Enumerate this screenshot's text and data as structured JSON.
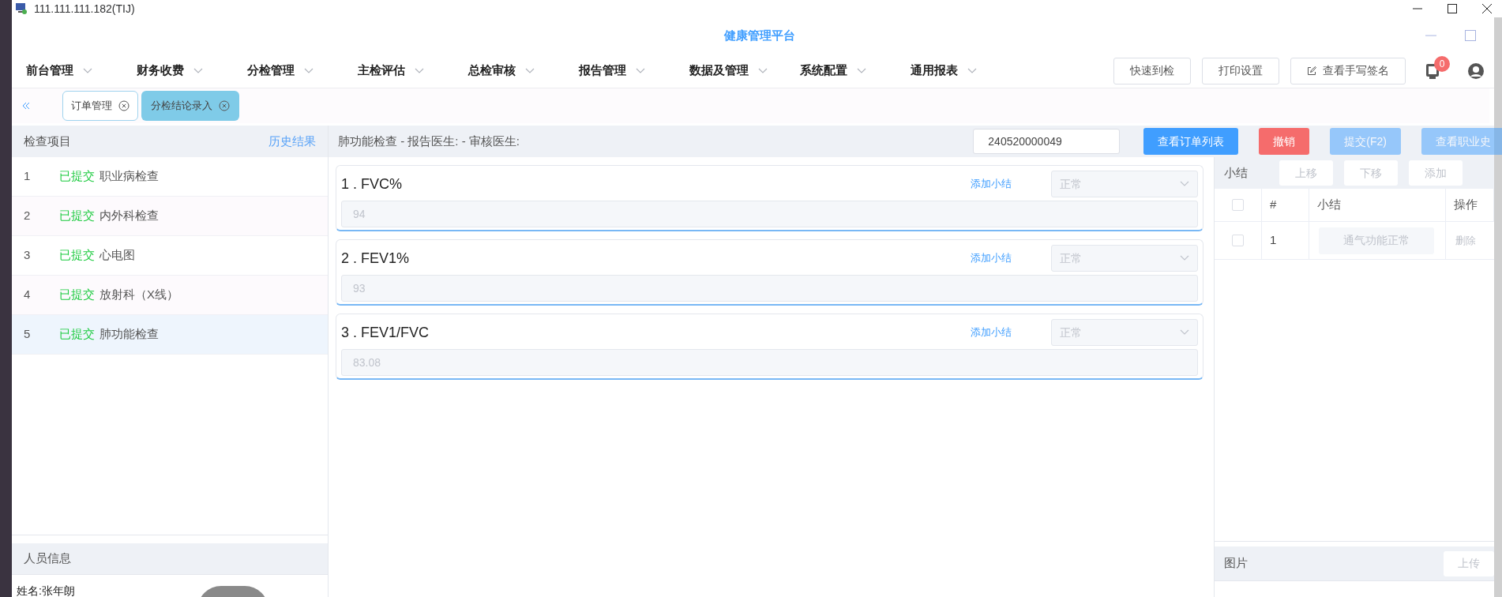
{
  "titlebar": {
    "title": "111.111.111.182(TIJ)"
  },
  "app_title": "健康管理平台",
  "menu": [
    {
      "label": "前台管理"
    },
    {
      "label": "财务收费"
    },
    {
      "label": "分检管理"
    },
    {
      "label": "主检评估"
    },
    {
      "label": "总检审核"
    },
    {
      "label": "报告管理"
    },
    {
      "label": "数据及管理"
    },
    {
      "label": "系统配置"
    },
    {
      "label": "通用报表"
    }
  ],
  "toolbar_buttons": [
    {
      "label": "快速到检",
      "kind": "plain"
    },
    {
      "label": "打印设置",
      "kind": "plain"
    },
    {
      "label": "查看手写签名",
      "kind": "edit"
    }
  ],
  "notifications": {
    "count": "0"
  },
  "tabs": [
    {
      "label": "订单管理",
      "selected": false
    },
    {
      "label": "分检结论录入",
      "selected": true
    }
  ],
  "exam_list": {
    "title": "检查项目",
    "history_link": "历史结果",
    "items": [
      {
        "index": "1",
        "status": "已提交",
        "name": "职业病检查",
        "selected": false
      },
      {
        "index": "2",
        "status": "已提交",
        "name": "内外科检查",
        "selected": false
      },
      {
        "index": "3",
        "status": "已提交",
        "name": "心电图",
        "selected": false
      },
      {
        "index": "4",
        "status": "已提交",
        "name": "放射科（X线）",
        "selected": false
      },
      {
        "index": "5",
        "status": "已提交",
        "name": "肺功能检查",
        "selected": true
      }
    ]
  },
  "person_info": {
    "title": "人员信息",
    "name": "姓名:张年朗"
  },
  "detail": {
    "title": "肺功能检查 - 报告医生: - 审核医生:",
    "order_number": "240520000049",
    "buttons": [
      {
        "label": "查看订单列表",
        "kind": "primary",
        "disabled": false
      },
      {
        "label": "撤销",
        "kind": "danger",
        "disabled": false
      },
      {
        "label": "提交(F2)",
        "kind": "primary",
        "disabled": true
      },
      {
        "label": "查看职业史",
        "kind": "primary",
        "disabled": true
      }
    ]
  },
  "items": [
    {
      "title": "1 . FVC%",
      "add_link": "添加小结",
      "result": "正常",
      "value": "94",
      "disabled": true
    },
    {
      "title": "2 . FEV1%",
      "add_link": "添加小结",
      "result": "正常",
      "value": "93",
      "disabled": true
    },
    {
      "title": "3 . FEV1/FVC",
      "add_link": "添加小结",
      "result": "正常",
      "value": "83.08",
      "disabled": true
    }
  ],
  "summary": {
    "title": "小结",
    "all_checked": false,
    "buttons": [
      "上移",
      "下移",
      "添加"
    ],
    "columns": [
      "#",
      "小结",
      "操作"
    ],
    "rows": [
      {
        "checked": false,
        "index": "1",
        "summary": "通气功能正常",
        "action": "删除"
      }
    ]
  },
  "pictures": {
    "title": "图片",
    "upload": "上传"
  }
}
